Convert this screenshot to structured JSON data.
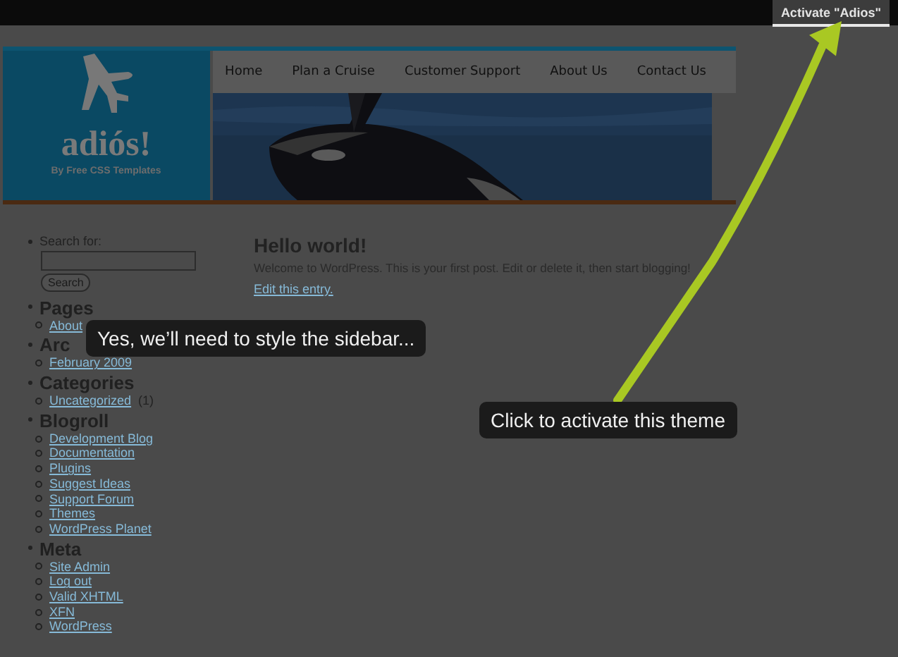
{
  "admin_bar": {
    "activate_button": "Activate \"Adios\""
  },
  "header": {
    "logo_title": "adiós!",
    "logo_tagline": "By Free CSS Templates",
    "nav": [
      "Home",
      "Plan a Cruise",
      "Customer Support",
      "About Us",
      "Contact Us"
    ]
  },
  "sidebar": {
    "search_label": "Search for:",
    "search_button": "Search",
    "sections": [
      {
        "title": "Pages",
        "links": [
          {
            "text": "About"
          }
        ]
      },
      {
        "title": "Arc",
        "links": [
          {
            "text": "February 2009"
          }
        ]
      },
      {
        "title": "Categories",
        "links": [
          {
            "text": "Uncategorized",
            "count": "(1)"
          }
        ]
      },
      {
        "title": "Blogroll",
        "links": [
          {
            "text": "Development Blog"
          },
          {
            "text": "Documentation"
          },
          {
            "text": "Plugins"
          },
          {
            "text": "Suggest Ideas"
          },
          {
            "text": "Support Forum"
          },
          {
            "text": "Themes"
          },
          {
            "text": "WordPress Planet"
          }
        ]
      },
      {
        "title": "Meta",
        "links": [
          {
            "text": "Site Admin"
          },
          {
            "text": "Log out"
          },
          {
            "text": "Valid XHTML"
          },
          {
            "text": "XFN"
          },
          {
            "text": "WordPress"
          }
        ]
      }
    ]
  },
  "post": {
    "title": "Hello world!",
    "body": "Welcome to WordPress. This is your first post. Edit or delete it, then start blogging!",
    "edit_link": "Edit this entry."
  },
  "tour_tips": [
    {
      "kind": "sidebar",
      "text": "Yes, we’ll need to style the sidebar..."
    },
    {
      "kind": "activate",
      "text": "Click to activate this theme"
    }
  ]
}
